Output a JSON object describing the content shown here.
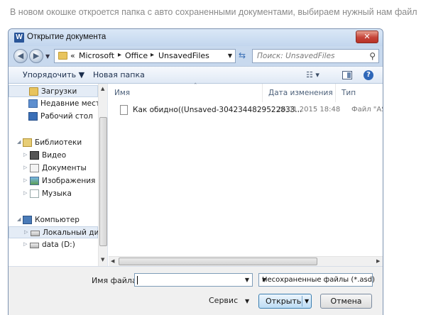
{
  "caption": "В новом окошке откроется папка с авто сохраненными документами, выбираем нужный нам файл",
  "window": {
    "app_icon": "W",
    "title": "Открытие документа",
    "close_glyph": "✕"
  },
  "address": {
    "prefix": "«",
    "crumbs": [
      "Microsoft",
      "Office",
      "UnsavedFiles"
    ],
    "separator": "▸",
    "search_placeholder": "Поиск: UnsavedFiles"
  },
  "toolbar": {
    "organize_label": "Упорядочить ▼",
    "new_folder_label": "Новая папка",
    "view_label": "☷ ▾",
    "help_label": "?"
  },
  "nav": [
    {
      "label": "Загрузки",
      "icon": "downloads-icon",
      "selected": true
    },
    {
      "label": "Недавние места",
      "icon": "recent-places-icon"
    },
    {
      "label": "Рабочий стол",
      "icon": "desktop-icon"
    },
    {
      "label": "Библиотеки",
      "icon": "libraries-icon"
    },
    {
      "label": "Видео",
      "icon": "video-icon"
    },
    {
      "label": "Документы",
      "icon": "documents-icon"
    },
    {
      "label": "Изображения",
      "icon": "images-icon"
    },
    {
      "label": "Музыка",
      "icon": "music-icon"
    },
    {
      "label": "Компьютер",
      "icon": "computer-icon"
    },
    {
      "label": "Локальный диск",
      "icon": "drive-icon"
    },
    {
      "label": "data (D:)",
      "icon": "drive-icon"
    }
  ],
  "columns": {
    "name": "Имя",
    "date": "Дата изменения",
    "type": "Тип"
  },
  "files": [
    {
      "name": "Как обидно((Unsaved-3042344829522833...",
      "date": "26.01.2015 18:48",
      "type": "Файл \"AS"
    }
  ],
  "bottom": {
    "filename_label": "Имя файла:",
    "filename_value": "",
    "filetype_value": "Несохраненные файлы (*.asd)",
    "service_label": "Сервис",
    "open_label": "Открыть",
    "cancel_label": "Отмена"
  },
  "colors": {
    "window_frame": "#c8d9ee",
    "close_red": "#c5443a",
    "open_button": "#bcdcf4"
  }
}
